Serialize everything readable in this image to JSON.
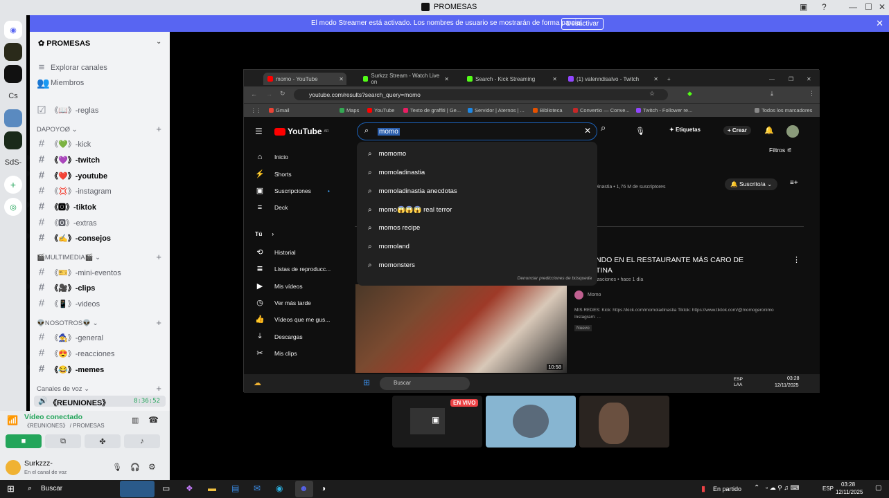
{
  "window": {
    "title": "PROMESAS"
  },
  "banner": {
    "message": "El modo Streamer está activado. Los nombres de usuario se mostrarán de forma parcial.",
    "button": "Desactivar"
  },
  "servers": [
    "Cs",
    "SdS-"
  ],
  "sidebar": {
    "server_name": "PROMESAS",
    "top": [
      {
        "label": "Explorar canales"
      },
      {
        "label": "Miembros"
      },
      {
        "label": "《📖》-reglas"
      }
    ],
    "categories": [
      {
        "name": "DAPOYOØ",
        "channels": [
          "《💚》-kick",
          "《💜》-twitch",
          "《❤️》-youtube",
          "《💢》-instagram",
          "《🅾》-tiktok",
          "《🅾》-extras",
          "《✍️》-consejos"
        ]
      },
      {
        "name": "🎬MULTIMEDIA🎬",
        "channels": [
          "《🎫》-mini-eventos",
          "《🎥》-clips",
          "《📱》-videos"
        ]
      },
      {
        "name": "👽NOSOTROS👽",
        "channels": [
          "《🧙》-general",
          "《😍》-reacciones",
          "《😂》-memes"
        ]
      },
      {
        "name": "Canales de voz",
        "channels": [
          "《REUNIONES》"
        ]
      }
    ],
    "voice_timer": "8:36:52"
  },
  "voice": {
    "status": "Vídeo conectado",
    "channel": "《REUNIONES》 / PROMESAS",
    "user": "Surkzzz-",
    "user_status": "En el canal de voz"
  },
  "browser": {
    "tabs": [
      "momo - YouTube",
      "Surkzz Stream - Watch Live on",
      "Search - Kick Streaming",
      "(1) valenndisalvo - Twitch"
    ],
    "url": "youtube.com/results?search_query=momo",
    "bookmarks": [
      "Gmail",
      "Maps",
      "YouTube",
      "Texto de graffiti | Ge...",
      "Servidor | Aternos | ...",
      "Biblioteca",
      "Convertio — Conve...",
      "Twitch - Follower re...",
      "Todos los marcadores"
    ]
  },
  "youtube": {
    "logo": "YouTube",
    "country": "AR",
    "query": "momo",
    "suggestions": [
      "momomo",
      "momoladinastia",
      "momoladinastia anecdotas",
      "momo😱😱😱 real terror",
      "momos recipe",
      "momoland",
      "momonsters"
    ],
    "report": "Denunciar predicciones de búsqueda",
    "nav": [
      "Inicio",
      "Shorts",
      "Suscripciones",
      "Deck"
    ],
    "you_section": "Tú",
    "you_nav": [
      "Historial",
      "Listas de reproducc...",
      "Mis vídeos",
      "Ver más tarde",
      "Vídeos que me gus...",
      "Descargas",
      "Mis clips"
    ],
    "create": "Crear",
    "labels": "Etiquetas",
    "filters": "Filtros",
    "subscribed": "Suscrito/a",
    "channel_sub": "Dinastia • 1,76 M de suscriptores",
    "video_title": "NDO EN EL RESTAURANTE MÁS CARO DE\nTINA",
    "video_meta": "izaciones • hace 1 día",
    "video_channel": "Momo",
    "video_desc": "MIS REDES: Kick: https://kick.com/momoladinastia Tiktok: https://www.tiktok.com/@momogeronimo",
    "video_desc2": "Instagram: ...",
    "new_badge": "Nuevo",
    "duration": "10:58"
  },
  "inner_taskbar": {
    "search": "Buscar",
    "lang": "ESP\nLAA",
    "time": "03:28",
    "date": "12/11/2025"
  },
  "tiles": {
    "live": "EN VIVO"
  },
  "taskbar": {
    "search": "Buscar",
    "game": "En partido",
    "lang": "ESP",
    "time": "03:28",
    "date": "12/11/2025"
  },
  "colors": {
    "blurple": "#5865f2",
    "green": "#23a55a",
    "red": "#ff0000"
  }
}
